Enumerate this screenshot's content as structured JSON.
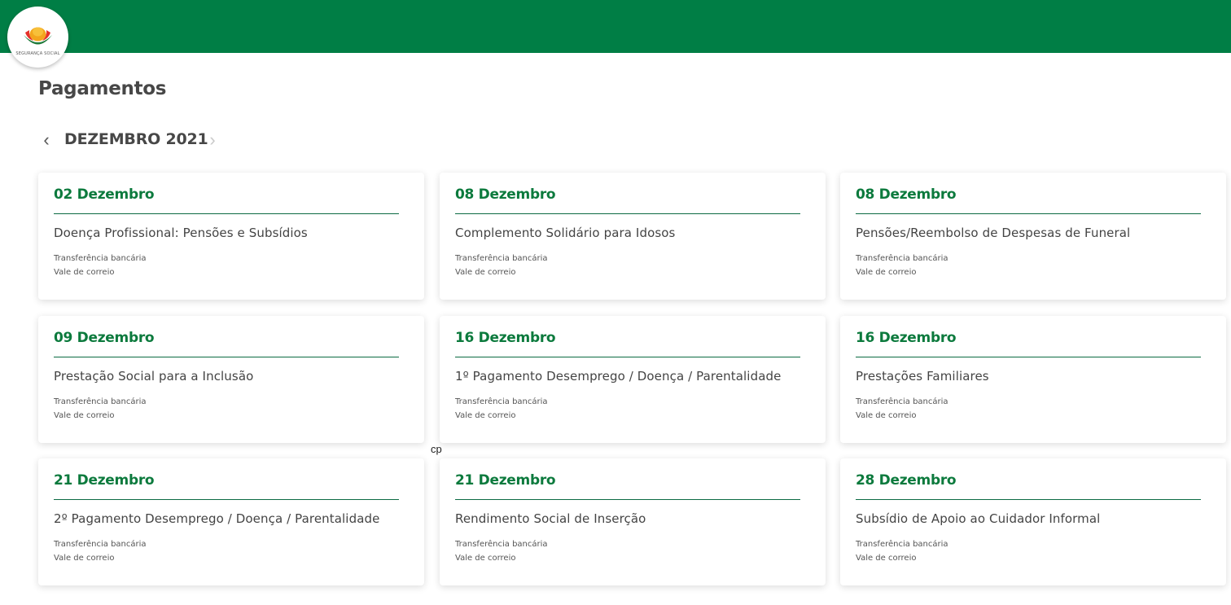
{
  "header": {
    "logo_text": "SEGURANÇA SOCIAL",
    "brand_color": "#007e45",
    "logo_icon": "seguranca-social-logo"
  },
  "page": {
    "title": "Pagamentos",
    "stray_text": "cp"
  },
  "month_nav": {
    "label": "DEZEMBRO 2021",
    "prev_icon": "‹",
    "next_icon": "›"
  },
  "cards": [
    {
      "date": "02 Dezembro",
      "title": "Doença Profissional: Pensões e Subsídios",
      "method1": "Transferência bancária",
      "method2": "Vale de correio"
    },
    {
      "date": "08 Dezembro",
      "title": "Complemento Solidário para Idosos",
      "method1": "Transferência bancária",
      "method2": "Vale de correio"
    },
    {
      "date": "08 Dezembro",
      "title": "Pensões/Reembolso de Despesas de Funeral",
      "method1": "Transferência bancária",
      "method2": "Vale de correio"
    },
    {
      "date": "09 Dezembro",
      "title": "Prestação Social para a Inclusão",
      "method1": "Transferência bancária",
      "method2": "Vale de correio"
    },
    {
      "date": "16 Dezembro",
      "title": "1º Pagamento Desemprego / Doença / Parentalidade",
      "method1": "Transferência bancária",
      "method2": "Vale de correio"
    },
    {
      "date": "16 Dezembro",
      "title": "Prestações Familiares",
      "method1": "Transferência bancária",
      "method2": "Vale de correio"
    },
    {
      "date": "21 Dezembro",
      "title": "2º Pagamento Desemprego / Doença / Parentalidade",
      "method1": "Transferência bancária",
      "method2": "Vale de correio"
    },
    {
      "date": "21 Dezembro",
      "title": "Rendimento Social de Inserção",
      "method1": "Transferência bancária",
      "method2": "Vale de correio"
    },
    {
      "date": "28 Dezembro",
      "title": "Subsídio de Apoio ao Cuidador Informal",
      "method1": "Transferência bancária",
      "method2": "Vale de correio"
    }
  ]
}
